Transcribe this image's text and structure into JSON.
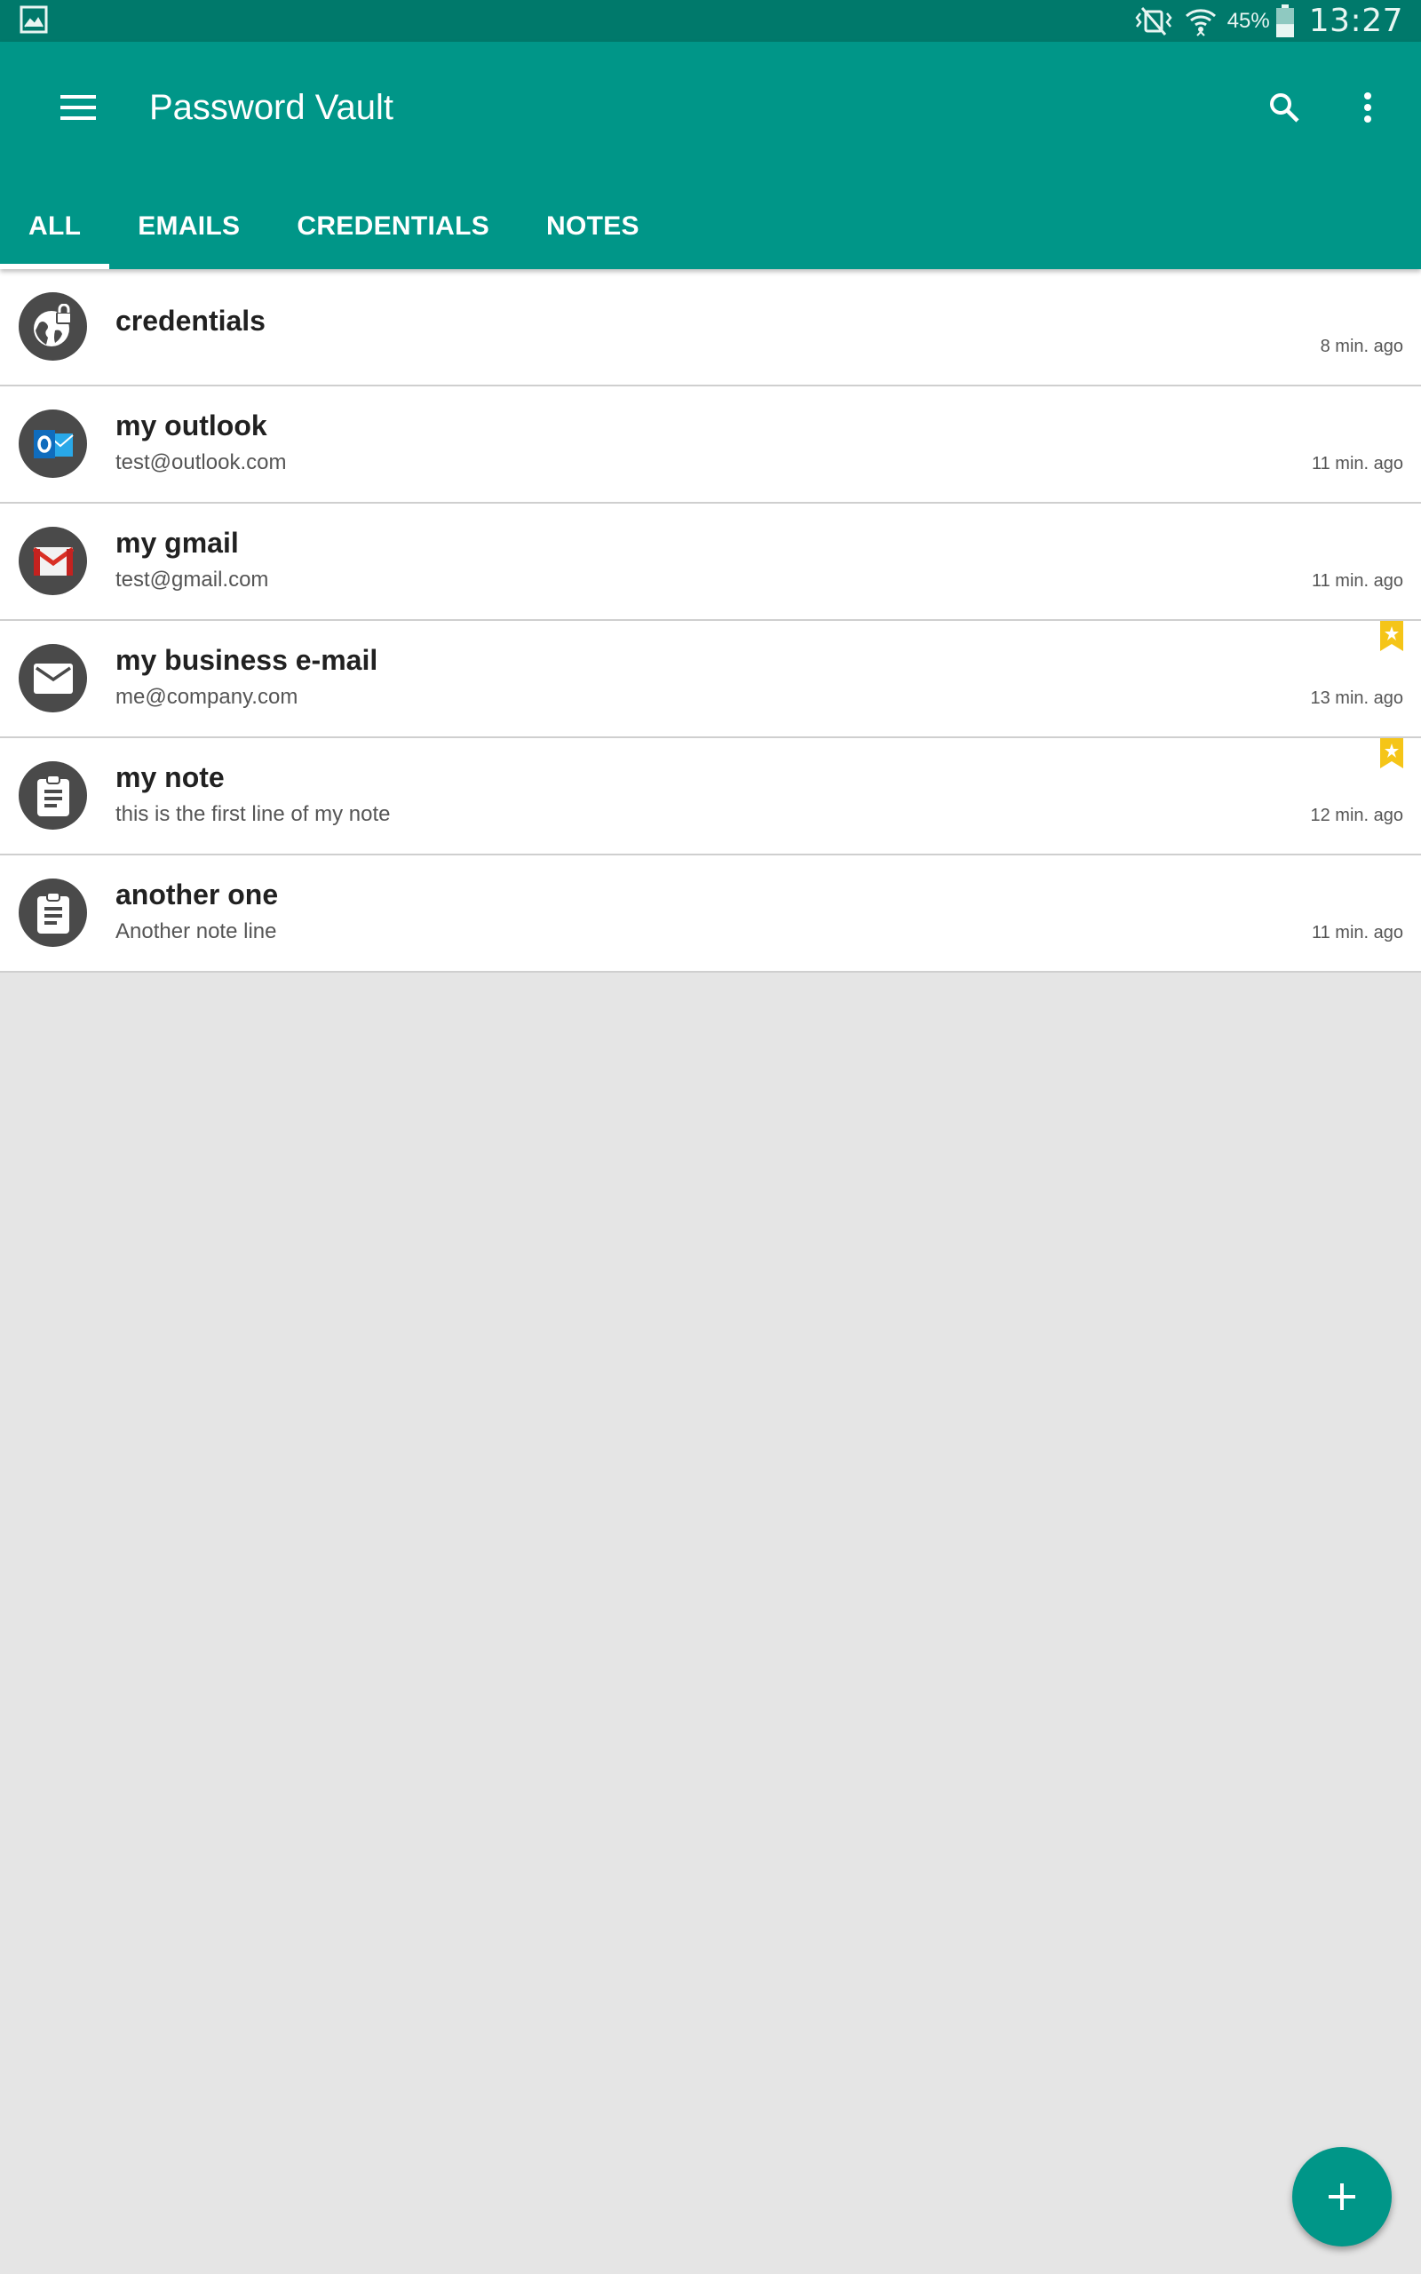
{
  "status_bar": {
    "battery_percent": "45%",
    "clock": "13:27",
    "icons": [
      "gallery-icon",
      "vibrate-mute-icon",
      "wifi-icon",
      "battery-icon"
    ],
    "battery_level": 0.45
  },
  "app_bar": {
    "title": "Password Vault",
    "icons": [
      "menu-icon",
      "search-icon",
      "more-vert-icon"
    ],
    "color": "#009688"
  },
  "tabs": [
    {
      "label": "ALL",
      "active": true
    },
    {
      "label": "EMAILS",
      "active": false
    },
    {
      "label": "CREDENTIALS",
      "active": false
    },
    {
      "label": "NOTES",
      "active": false
    }
  ],
  "items": [
    {
      "title": "credentials",
      "subtitle": "",
      "time": "8 min. ago",
      "icon": "globe-lock-icon",
      "favorite": false
    },
    {
      "title": "my outlook",
      "subtitle": "test@outlook.com",
      "time": "11 min. ago",
      "icon": "outlook-icon",
      "favorite": false
    },
    {
      "title": "my gmail",
      "subtitle": "test@gmail.com",
      "time": "11 min. ago",
      "icon": "gmail-icon",
      "favorite": false
    },
    {
      "title": "my business e-mail",
      "subtitle": "me@company.com",
      "time": "13 min. ago",
      "icon": "envelope-icon",
      "favorite": true
    },
    {
      "title": "my note",
      "subtitle": "this is the first line of my note",
      "time": "12 min. ago",
      "icon": "clipboard-icon",
      "favorite": true
    },
    {
      "title": "another one",
      "subtitle": "Another note line",
      "time": "11 min. ago",
      "icon": "clipboard-icon",
      "favorite": false
    }
  ],
  "fab": {
    "icon": "plus-icon",
    "color": "#009688"
  },
  "colors": {
    "primary": "#009688",
    "primary_dark": "#00796b",
    "favorite": "#f5c518",
    "background": "#e5e5e5"
  }
}
